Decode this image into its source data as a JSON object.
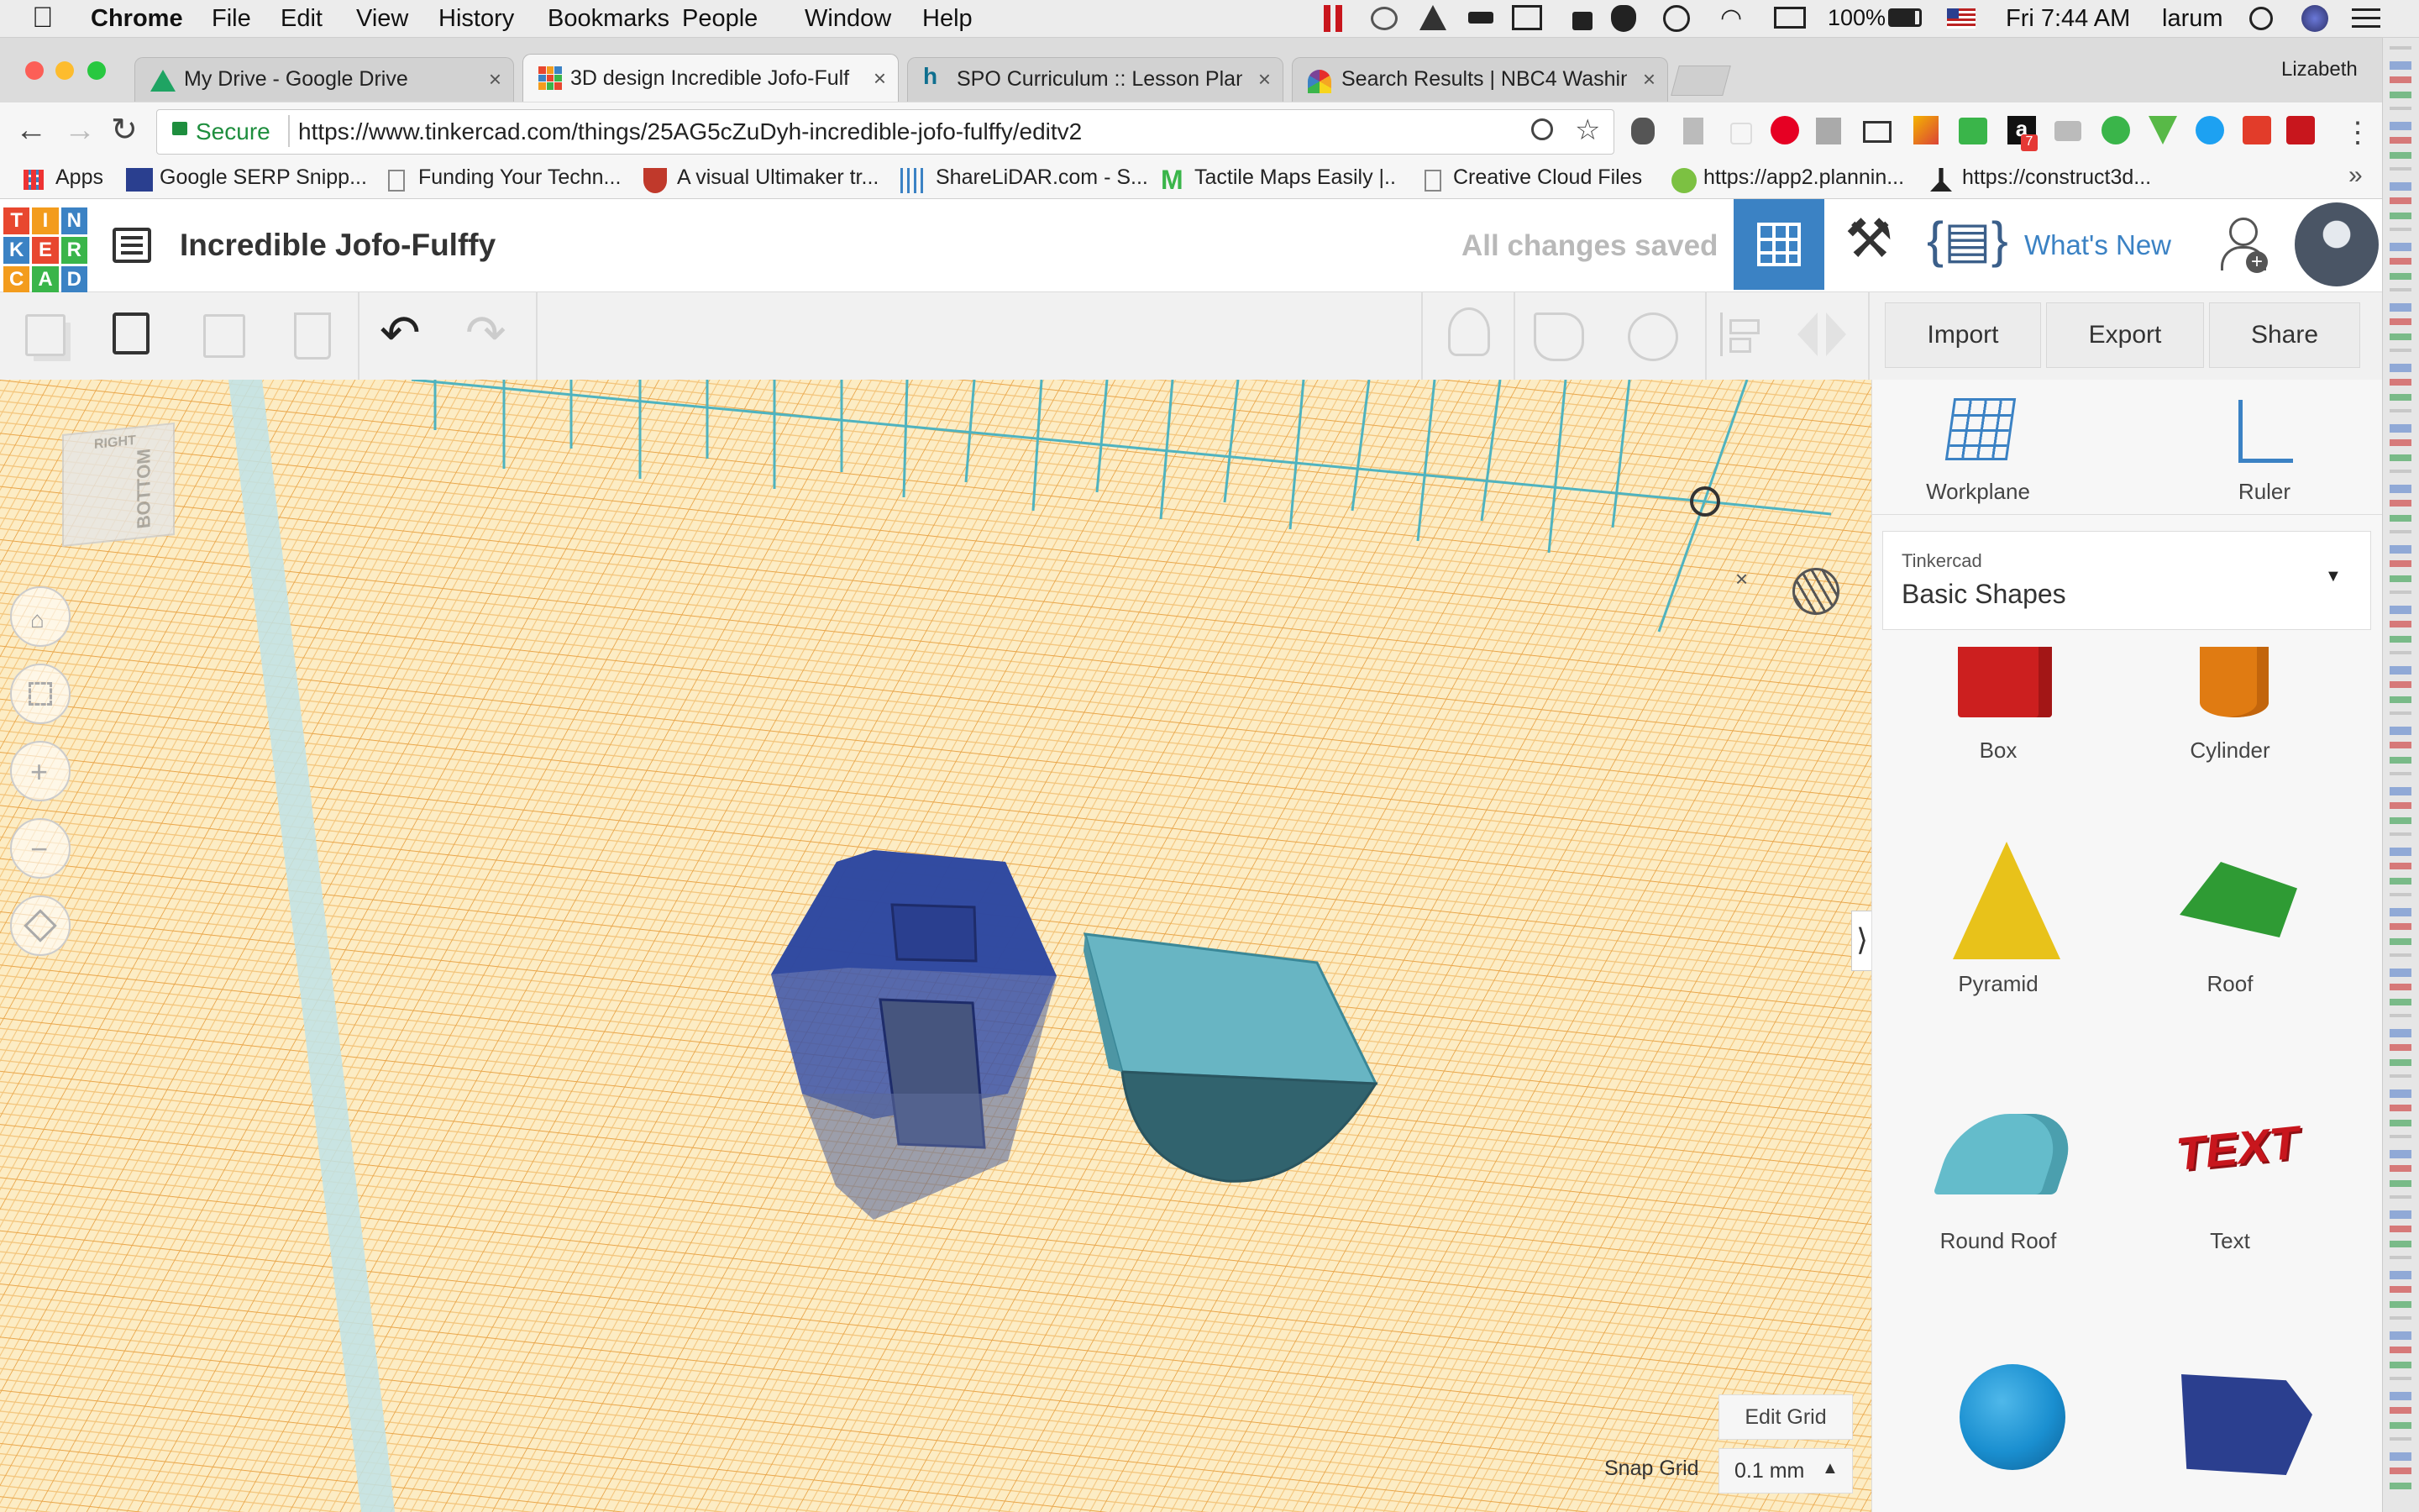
{
  "menubar": {
    "app": "Chrome",
    "items": [
      "File",
      "Edit",
      "View",
      "History",
      "Bookmarks",
      "People",
      "Window",
      "Help"
    ],
    "battery": "100%",
    "clock": "Fri 7:44 AM",
    "user": "larum"
  },
  "tabs": [
    {
      "title": "My Drive - Google Drive",
      "close": "×"
    },
    {
      "title": "3D design Incredible Jofo-Fulf",
      "close": "×"
    },
    {
      "title": "SPO Curriculum :: Lesson Plan",
      "close": "×"
    },
    {
      "title": "Search Results | NBC4 Washin",
      "close": "×"
    }
  ],
  "profile_name": "Lizabeth",
  "omnibox": {
    "secure_label": "Secure",
    "url": "https://www.tinkercad.com/things/25AG5cZuDyh-incredible-jofo-fulffy/editv2"
  },
  "bookmarks": [
    "Apps",
    "Google SERP Snipp...",
    "Funding Your Techn...",
    "A visual Ultimaker tr...",
    "ShareLiDAR.com - S...",
    "Tactile Maps Easily |..",
    "Creative Cloud Files",
    "https://app2.plannin...",
    "https://construct3d..."
  ],
  "extension_badge": "7",
  "tinkercad": {
    "logo_letters": [
      "T",
      "I",
      "N",
      "K",
      "E",
      "R",
      "C",
      "A",
      "D"
    ],
    "design_title": "Incredible Jofo-Fulffy",
    "save_status": "All changes saved",
    "whats_new": "What's New"
  },
  "actions": {
    "import": "Import",
    "export": "Export",
    "share": "Share"
  },
  "viewcube": {
    "face_top": "RIGHT",
    "face_front": "BOTTOM"
  },
  "panel": {
    "workplane": "Workplane",
    "ruler": "Ruler",
    "library_source": "Tinkercad",
    "library_name": "Basic Shapes",
    "shapes": [
      "Box",
      "Cylinder",
      "Pyramid",
      "Roof",
      "Round Roof",
      "Text"
    ]
  },
  "grid": {
    "edit_grid": "Edit Grid",
    "snap_label": "Snap Grid",
    "snap_value": "0.1 mm"
  },
  "colors": {
    "tinkercad_blue": "#3b82c4",
    "grid_bg": "#fcecc4",
    "box_red": "#cc1f1f",
    "cylinder_orange": "#e07b12",
    "pyramid_yellow": "#e8c21a",
    "roof_green": "#2f9b34",
    "round_roof_teal": "#64bccb",
    "sphere_blue": "#1a8fd0"
  }
}
